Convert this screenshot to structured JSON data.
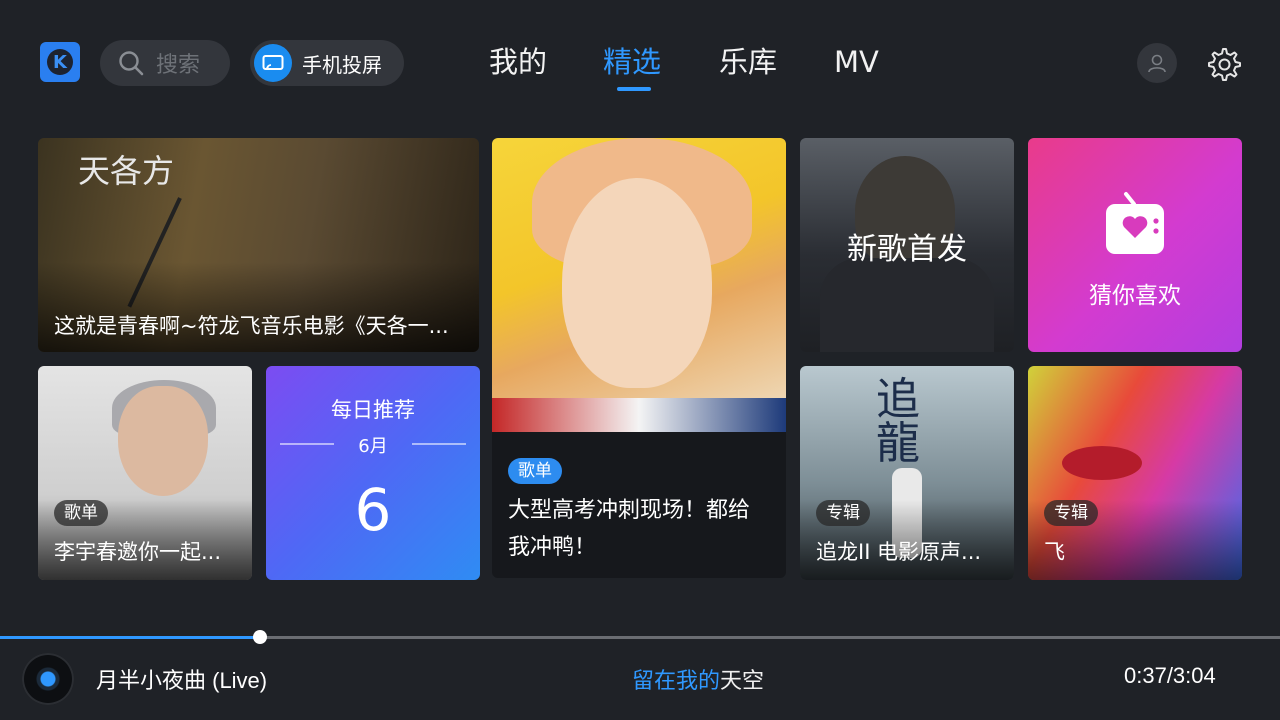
{
  "header": {
    "logo_letter": "K",
    "search": {
      "placeholder": "搜索"
    },
    "cast_label": "手机投屏",
    "tabs": [
      {
        "label": "我的",
        "active": false
      },
      {
        "label": "精选",
        "active": true
      },
      {
        "label": "乐库",
        "active": false
      },
      {
        "label": "MV",
        "active": false
      }
    ]
  },
  "cards": {
    "fulongfei": {
      "title": "这就是青春啊~符龙飞音乐电影《天各一...",
      "art_text": "天各方"
    },
    "manga": {
      "badge": "歌单",
      "desc": "大型高考冲刺现场！都给我冲鸭！"
    },
    "newsong": {
      "label": "新歌首发"
    },
    "guess": {
      "label": "猜你喜欢"
    },
    "liyuchun": {
      "badge": "歌单",
      "title": "李宇春邀你一起..."
    },
    "daily": {
      "title": "每日推荐",
      "month": "6月",
      "day": "6"
    },
    "chasing": {
      "badge": "专辑",
      "title": "追龙II 电影原声...",
      "art_text": "追龍"
    },
    "fei": {
      "badge": "专辑",
      "title": "飞"
    }
  },
  "player": {
    "progress_fraction": 0.203,
    "now_playing": "月半小夜曲 (Live)",
    "lyric_sung": "留在我的",
    "lyric_unsung": "天空",
    "time": "0:37/3:04"
  },
  "colors": {
    "accent": "#2f98ff",
    "background": "#1f2227"
  }
}
